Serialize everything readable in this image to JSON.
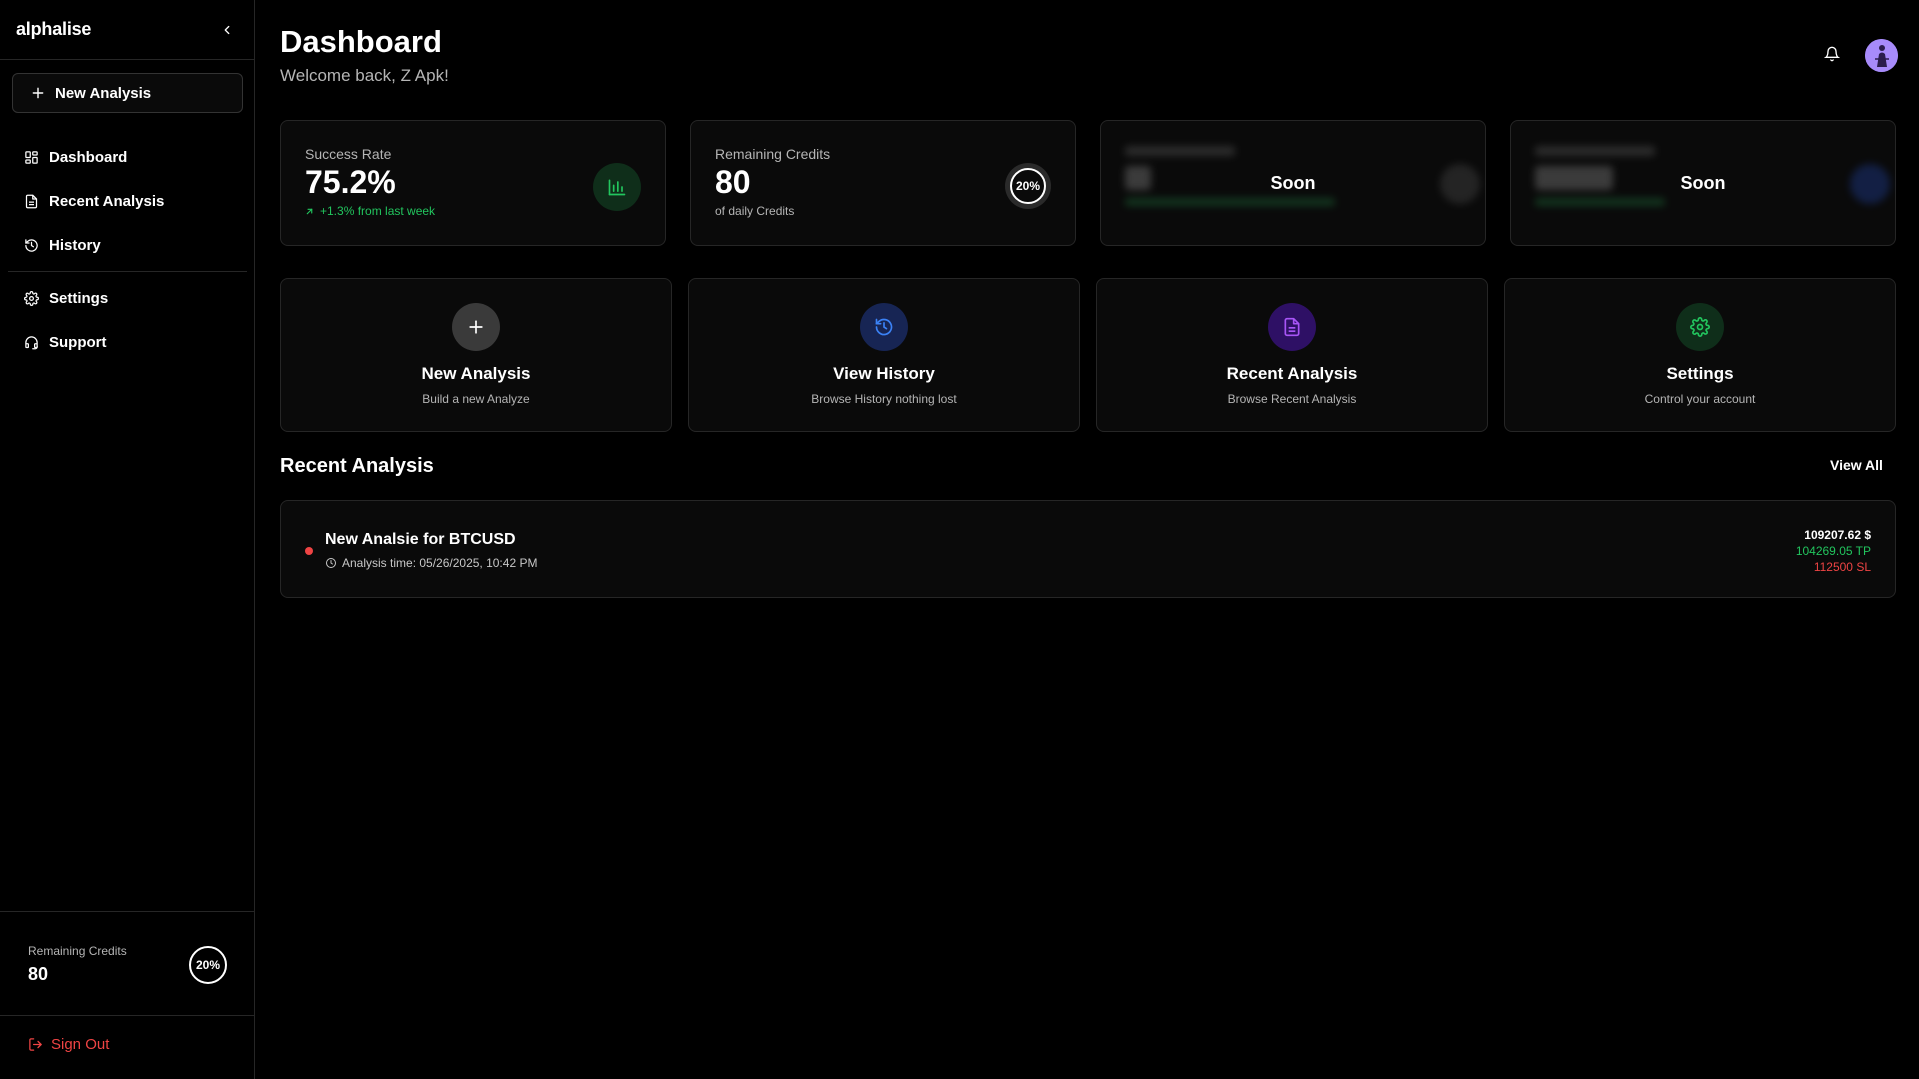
{
  "app": {
    "brand": "alphalise"
  },
  "sidebar": {
    "new_analysis_label": "New Analysis",
    "items": [
      {
        "label": "Dashboard",
        "icon": "grid-icon"
      },
      {
        "label": "Recent Analysis",
        "icon": "file-icon"
      },
      {
        "label": "History",
        "icon": "history-icon"
      },
      {
        "label": "Settings",
        "icon": "gear-icon"
      },
      {
        "label": "Support",
        "icon": "headset-icon"
      }
    ],
    "credits_label": "Remaining Credits",
    "credits_value": "80",
    "credits_percent": "20%",
    "sign_out_label": "Sign Out"
  },
  "header": {
    "title": "Dashboard",
    "subtitle": "Welcome back, Z Apk!"
  },
  "stats": [
    {
      "label": "Success Rate",
      "value": "75.2%",
      "note": "+1.3% from last week",
      "icon": "bar-chart-icon",
      "color": "#22c55e"
    },
    {
      "label": "Remaining Credits",
      "value": "80",
      "note": "of daily Credits",
      "ring": "20%"
    },
    {
      "overlay": "Soon"
    },
    {
      "overlay": "Soon"
    }
  ],
  "actions": [
    {
      "title": "New Analysis",
      "subtitle": "Build a new Analyze",
      "icon": "plus-icon",
      "color": "#ffffff"
    },
    {
      "title": "View History",
      "subtitle": "Browse History nothing lost",
      "icon": "history-icon",
      "color": "#3b82f6"
    },
    {
      "title": "Recent Analysis",
      "subtitle": "Browse Recent Analysis",
      "icon": "file-icon",
      "color": "#a855f7"
    },
    {
      "title": "Settings",
      "subtitle": "Control your account",
      "icon": "gear-icon",
      "color": "#22c55e"
    }
  ],
  "recent": {
    "title": "Recent Analysis",
    "view_all": "View All",
    "items": [
      {
        "title": "New Analsie for BTCUSD",
        "time": "Analysis time: 05/26/2025, 10:42 PM",
        "price": "109207.62 $",
        "tp": "104269.05 TP",
        "sl": "112500 SL",
        "status_color": "#ef4444"
      }
    ]
  }
}
